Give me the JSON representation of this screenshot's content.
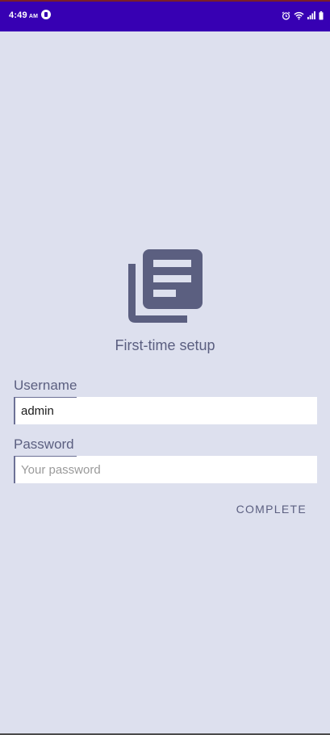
{
  "status_bar": {
    "time": "4:49",
    "ampm": "AM",
    "app_icon": "flipboard-icon",
    "right_icons": [
      "alarm-icon",
      "wifi-icon",
      "signal-icon",
      "battery-icon"
    ],
    "background_color": "#3700b3"
  },
  "logo": {
    "icon": "library-books-icon",
    "color": "#5b5f80"
  },
  "setup": {
    "title": "First-time setup"
  },
  "form": {
    "username": {
      "label": "Username",
      "value": "admin",
      "placeholder": ""
    },
    "password": {
      "label": "Password",
      "value": "",
      "placeholder": "Your password"
    },
    "complete_label": "COMPLETE"
  },
  "colors": {
    "background": "#dde0ee",
    "accent": "#5b5f80"
  }
}
